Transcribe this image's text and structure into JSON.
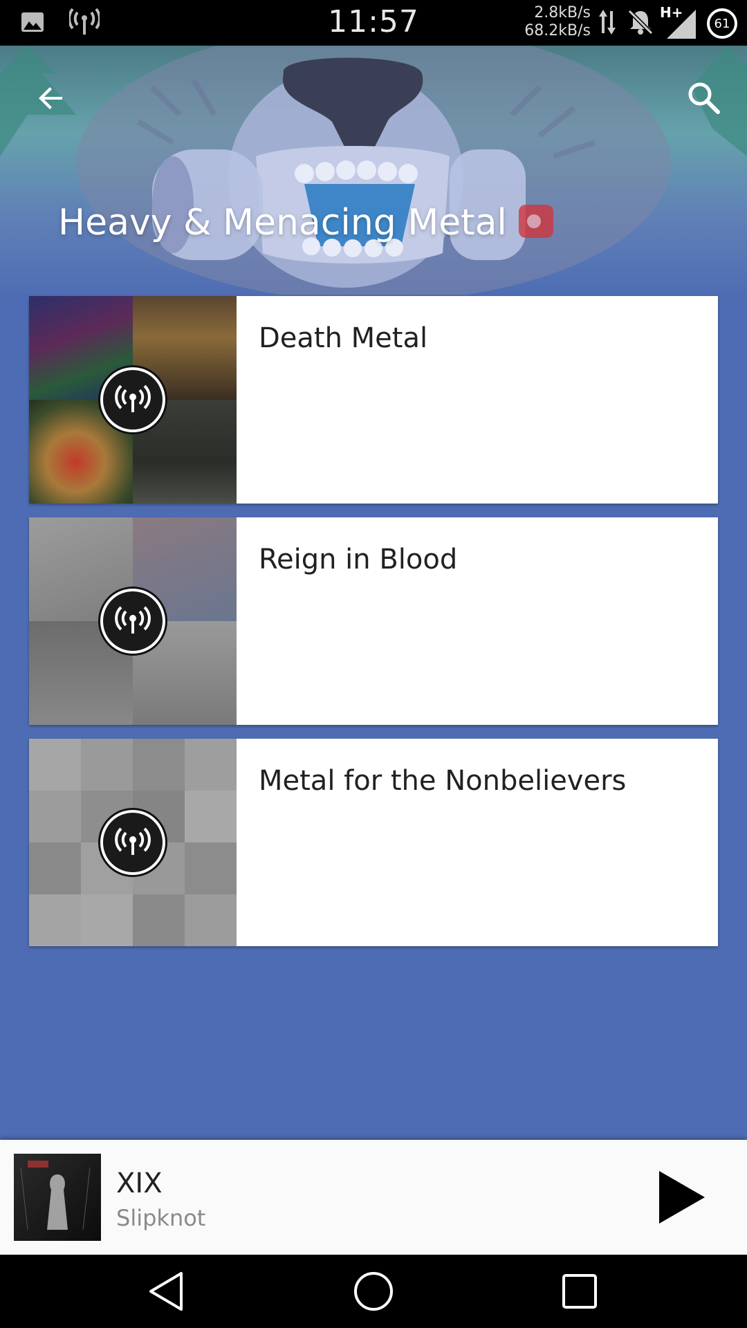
{
  "status_bar": {
    "time": "11:57",
    "upload_speed": "2.8kB/s",
    "download_speed": "68.2kB/s",
    "network_type": "H+",
    "battery_level": "61",
    "icons": [
      "image-icon",
      "broadcast-icon",
      "data-transfer-icon",
      "notifications-off-icon",
      "signal-icon",
      "battery-icon"
    ]
  },
  "header": {
    "title": "Heavy & Menacing Metal",
    "back_icon": "arrow-back-icon",
    "search_icon": "search-icon"
  },
  "stations": [
    {
      "name": "Death Metal",
      "icon": "radio-icon"
    },
    {
      "name": "Reign in Blood",
      "icon": "radio-icon"
    },
    {
      "name": "Metal for the Nonbelievers",
      "icon": "radio-icon"
    }
  ],
  "now_playing": {
    "title": "XIX",
    "artist": "Slipknot",
    "play_icon": "play-icon"
  },
  "nav_bar": {
    "icons": [
      "back-triangle-icon",
      "home-circle-icon",
      "recents-square-icon"
    ]
  },
  "colors": {
    "background": "#4e6cb3",
    "status_bar": "#000000",
    "card": "#ffffff",
    "now_playing": "#fafafa"
  }
}
